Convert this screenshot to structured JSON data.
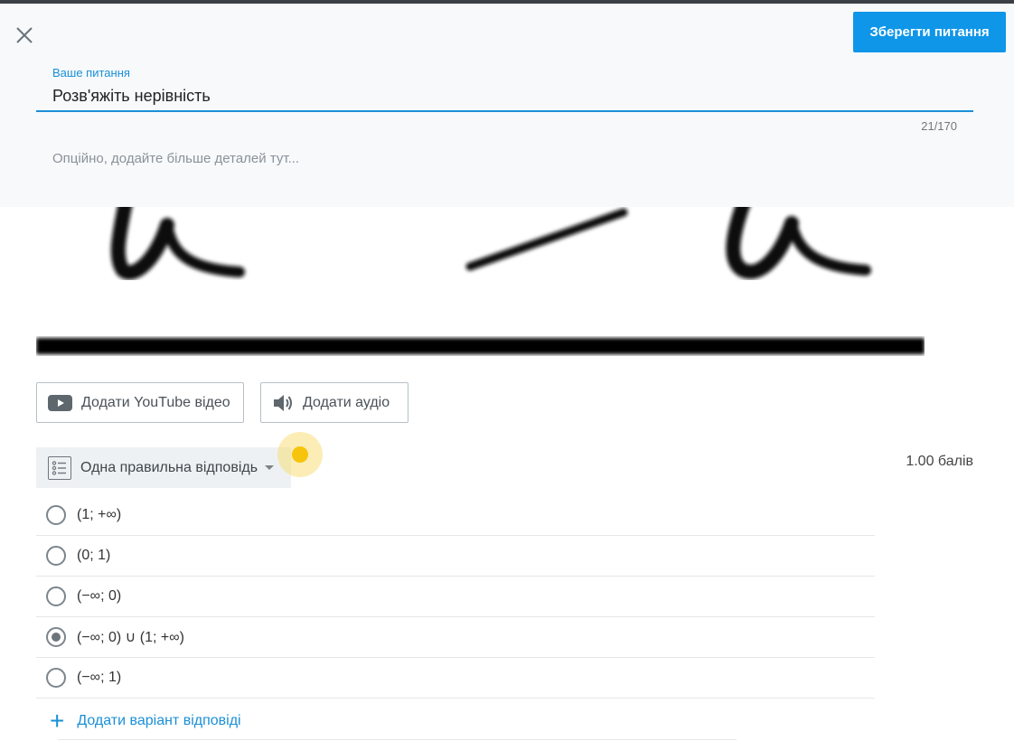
{
  "header": {
    "close_icon": "close-icon",
    "save_label": "Зберегти питання",
    "question_label": "Ваше питання",
    "question_value": "Розв'яжіть нерівність",
    "counter": "21/170",
    "details_placeholder": "Опційно, додайте більше деталей тут..."
  },
  "media": {
    "youtube_label": "Додати YouTube відео",
    "audio_label": "Додати аудіо"
  },
  "question_type": {
    "label": "Одна правильна відповідь",
    "points": "1.00 балів"
  },
  "options": [
    {
      "text": "(1; +∞)",
      "checked": false
    },
    {
      "text": "(0; 1)",
      "checked": false
    },
    {
      "text": "(−∞; 0)",
      "checked": false
    },
    {
      "text": "(−∞; 0) ∪ (1; +∞)",
      "checked": true
    },
    {
      "text": "(−∞; 1)",
      "checked": false
    }
  ],
  "add_option_label": "Додати варіант відповіді",
  "colors": {
    "accent": "#0f96e8",
    "header_bg": "#f7f9fb",
    "highlight": "#f6c40d"
  }
}
